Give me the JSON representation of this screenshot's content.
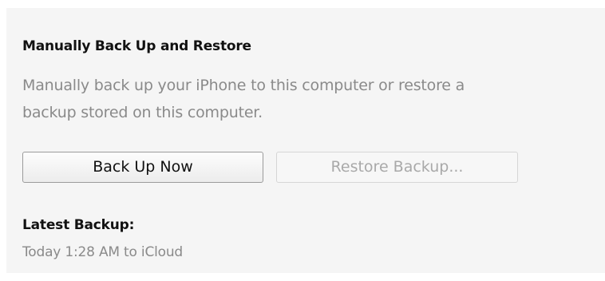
{
  "backup_section": {
    "title": "Manually Back Up and Restore",
    "description_lines": [
      "Manually back up your iPhone to this computer or restore a",
      "backup stored on this computer."
    ],
    "back_up_now_label": "Back Up Now",
    "restore_backup_label": "Restore Backup...",
    "restore_backup_enabled": false,
    "latest_backup_label": "Latest Backup:",
    "latest_backup_value": "Today 1:28 AM to iCloud"
  },
  "colors": {
    "panel_background": "#f5f5f5",
    "heading_text": "#111111",
    "secondary_text": "#8a8a8a",
    "disabled_text": "#a9a9a9"
  }
}
